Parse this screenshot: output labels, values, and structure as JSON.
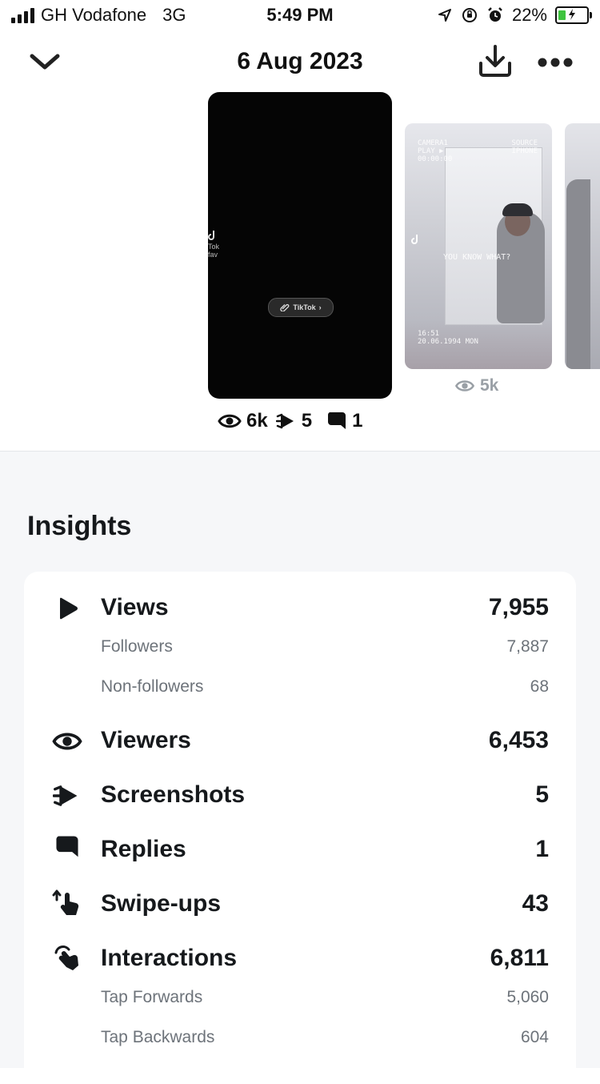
{
  "status_bar": {
    "carrier": "GH Vodafone",
    "network": "3G",
    "time": "5:49 PM",
    "battery_percent": "22%"
  },
  "header": {
    "title": "6 Aug 2023",
    "back_icon": "chevron-down-icon",
    "download_icon": "download-icon",
    "more_icon": "more-icon"
  },
  "stories": {
    "current": {
      "pill_label": "TikTok",
      "views": "6k",
      "screenshots": "5",
      "replies": "1"
    },
    "next": {
      "views": "5k",
      "overlay_top_left": "CAMERA1\nPLAY ▶\n00:00:00",
      "overlay_top_right": "SOURCE\nIPHONE",
      "overlay_caption": "YOU KNOW WHAT?",
      "overlay_bottom": "16:51\n20.06.1994 MON"
    }
  },
  "insights": {
    "title": "Insights",
    "rows": [
      {
        "label": "Views",
        "value": "7,955",
        "icon": "play-icon"
      },
      {
        "label": "Followers",
        "value": "7,887"
      },
      {
        "label": "Non-followers",
        "value": "68"
      },
      {
        "label": "Viewers",
        "value": "6,453",
        "icon": "eye-icon"
      },
      {
        "label": "Screenshots",
        "value": "5",
        "icon": "screenshot-icon"
      },
      {
        "label": "Replies",
        "value": "1",
        "icon": "reply-bubble-icon"
      },
      {
        "label": "Swipe-ups",
        "value": "43",
        "icon": "swipe-up-icon"
      },
      {
        "label": "Interactions",
        "value": "6,811",
        "icon": "tap-hand-icon"
      },
      {
        "label": "Tap Forwards",
        "value": "5,060"
      },
      {
        "label": "Tap Backwards",
        "value": "604"
      }
    ]
  },
  "colors": {
    "background_lower": "#f6f7f9",
    "text_primary": "#16191c",
    "text_secondary": "#6d737a",
    "battery_fill": "#3ec33e"
  }
}
